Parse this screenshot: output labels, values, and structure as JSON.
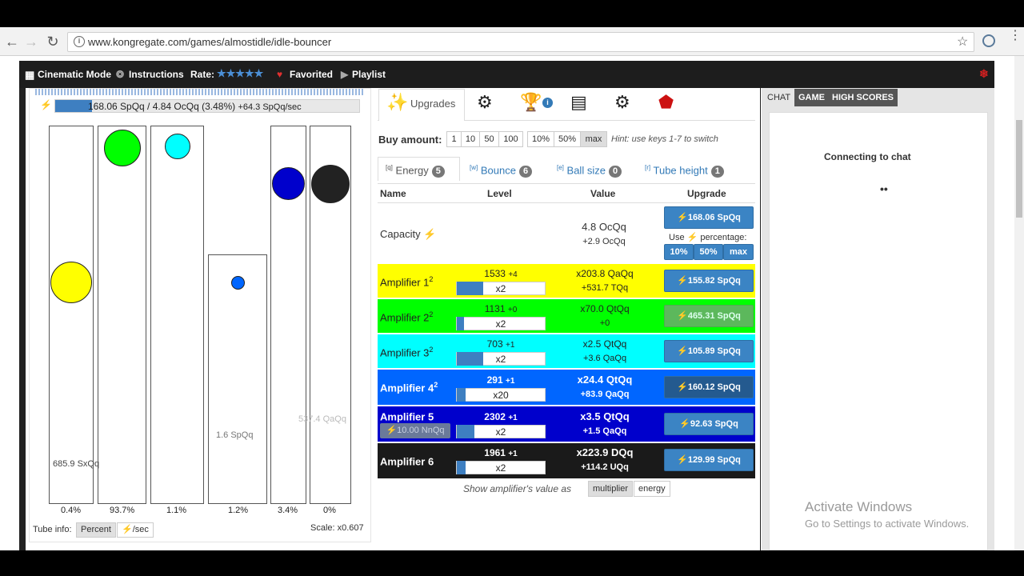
{
  "browser": {
    "url": "www.kongregate.com/games/almostidle/idle-bouncer",
    "info_icon": "i"
  },
  "kongbar": {
    "cinematic": "Cinematic Mode",
    "instructions": "Instructions",
    "rate": "Rate:",
    "stars": "★★★★★",
    "favorited": "Favorited",
    "playlist": "Playlist"
  },
  "energy": {
    "bolt": "⚡",
    "text": "168.06 SpQq / 4.84 OcQq (3.48%)",
    "rate": "+64.3 SpQq/sec",
    "fill_fraction": 0.0348
  },
  "tubes": [
    {
      "pct": "0.4%",
      "label": "685.9 SxQq",
      "ball_color": "#ffff00"
    },
    {
      "pct": "93.7%",
      "label": "",
      "ball_color": "#00ff00"
    },
    {
      "pct": "1.1%",
      "label": "",
      "ball_color": "#00ffff"
    },
    {
      "pct": "1.2%",
      "label": "1.6 SpQq",
      "ball_color": "#0066ff"
    },
    {
      "pct": "3.4%",
      "label": "",
      "ball_color": "#0000cc"
    },
    {
      "pct": "0%",
      "label": "537.4 QaQq",
      "ball_color": "#222222"
    }
  ],
  "tube_info": {
    "label": "Tube info:",
    "percent": "Percent",
    "persec": "⚡/sec",
    "scale": "Scale: x0.607"
  },
  "tabs": {
    "upgrades": "Upgrades"
  },
  "buy": {
    "label": "Buy amount:",
    "options": [
      "1",
      "10",
      "50",
      "100",
      "10%",
      "50%",
      "max"
    ],
    "hint": "Hint: use keys 1-7 to switch"
  },
  "subtabs": [
    {
      "key": "[q]",
      "label": "Energy",
      "count": "5"
    },
    {
      "key": "[w]",
      "label": "Bounce",
      "count": "6"
    },
    {
      "key": "[e]",
      "label": "Ball size",
      "count": "0"
    },
    {
      "key": "[r]",
      "label": "Tube height",
      "count": "1"
    }
  ],
  "table": {
    "headers": [
      "Name",
      "Level",
      "Value",
      "Upgrade"
    ],
    "capacity": {
      "name": "Capacity",
      "value": "4.8 OcQq",
      "delta": "+2.9 OcQq",
      "cost": "⚡168.06 SpQq",
      "use_label": "Use ⚡ percentage:",
      "pct_buttons": [
        "10%",
        "50%",
        "max"
      ]
    },
    "amplifiers": [
      {
        "name": "Amplifier 1",
        "sup": "2",
        "level": "1533",
        "lvl_delta": "+4",
        "mult": "x2",
        "value": "x203.8 QaQq",
        "delta": "+531.7 TQq",
        "cost": "⚡155.82 SpQq",
        "bg": "#ffff00",
        "fg": "#222",
        "fill": 0.3
      },
      {
        "name": "Amplifier 2",
        "sup": "2",
        "level": "1131",
        "lvl_delta": "+0",
        "mult": "x2",
        "value": "x70.0 QtQq",
        "delta": "+0",
        "cost": "⚡465.31 SpQq",
        "bg": "#00ff00",
        "fg": "#222",
        "fill": 0.08
      },
      {
        "name": "Amplifier 3",
        "sup": "2",
        "level": "703",
        "lvl_delta": "+1",
        "mult": "x2",
        "value": "x2.5 QtQq",
        "delta": "+3.6 QaQq",
        "cost": "⚡105.89 SpQq",
        "bg": "#00ffff",
        "fg": "#222",
        "fill": 0.3
      },
      {
        "name": "Amplifier 4",
        "sup": "2",
        "level": "291",
        "lvl_delta": "+1",
        "mult": "x20",
        "value": "x24.4 QtQq",
        "delta": "+83.9 QaQq",
        "cost": "⚡160.12 SpQq",
        "bg": "#0066ff",
        "fg": "#fff",
        "fill": 0.1
      },
      {
        "name": "Amplifier 5",
        "sup": "",
        "level": "2302",
        "lvl_delta": "+1",
        "mult": "x2",
        "value": "x3.5 QtQq",
        "delta": "+1.5 QaQq",
        "cost": "⚡92.63 SpQq",
        "bg": "#0000cc",
        "fg": "#fff",
        "fill": 0.2,
        "extra": "⚡10.00 NnQq"
      },
      {
        "name": "Amplifier 6",
        "sup": "",
        "level": "1961",
        "lvl_delta": "+1",
        "mult": "x2",
        "value": "x223.9 DQq",
        "delta": "+114.2 UQq",
        "cost": "⚡129.99 SpQq",
        "bg": "#1a1a1a",
        "fg": "#fff",
        "fill": 0.1
      }
    ]
  },
  "show_amp": {
    "label": "Show amplifier's value as",
    "multiplier": "multiplier",
    "energy": "energy"
  },
  "chat": {
    "tabs": [
      "CHAT",
      "GAME",
      "HIGH SCORES"
    ],
    "connecting": "Connecting to chat",
    "dots": "••"
  },
  "windows": {
    "title": "Activate Windows",
    "sub": "Go to Settings to activate Windows."
  },
  "colors": {
    "accent": "#3b84c4",
    "kong_bar": "#1d1d1d"
  }
}
